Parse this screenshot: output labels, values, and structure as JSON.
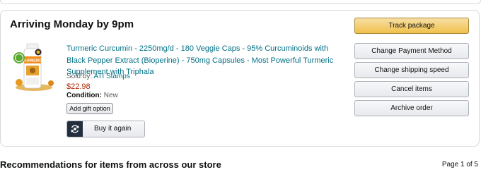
{
  "order": {
    "arrival": "Arriving Monday by 9pm",
    "product": {
      "title": "Turmeric Curcumin - 2250mg/d - 180 Veggie Caps - 95% Curcuminoids with Black Pepper Extract (Bioperine) - 750mg Capsules - Most Powerful Turmeric Supplement with Triphala",
      "sold_by_label": "Sold by:",
      "seller": "ATI Stamps",
      "price": "$22.98",
      "condition_label": "Condition:",
      "condition": "New",
      "image_label": "TURMERIC"
    },
    "gift_label": "Add gift option",
    "buy_again_label": "Buy it again",
    "actions": [
      "Track package",
      "Change Payment Method",
      "Change shipping speed",
      "Cancel items",
      "Archive order"
    ]
  },
  "recommendations": {
    "title": "Recommendations for items from across our store",
    "pager": "Page 1 of 5"
  },
  "colors": {
    "link": "#007185",
    "price": "#B12704",
    "primary_button": "#F0C14B"
  },
  "icons": {
    "buy_again": "reorder-icon"
  }
}
